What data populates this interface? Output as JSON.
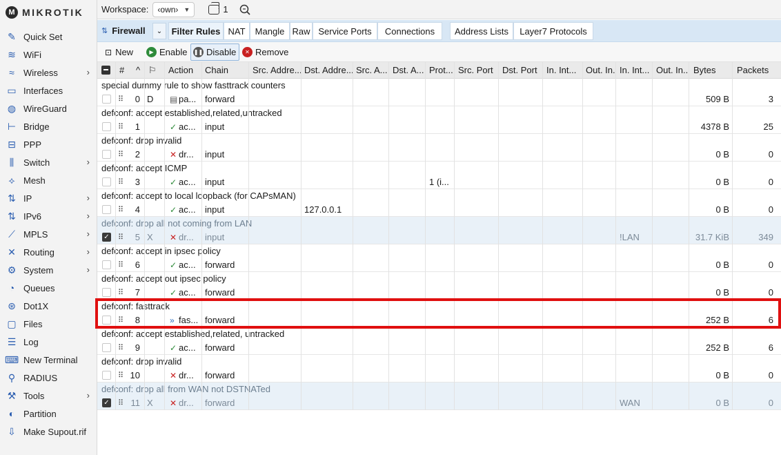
{
  "brand": "MIKROTIK",
  "nav": [
    {
      "label": "Quick Set",
      "icon": "wand-icon",
      "glyph": "✎",
      "chevron": false
    },
    {
      "label": "WiFi",
      "icon": "wifi-icon",
      "glyph": "≋",
      "chevron": false
    },
    {
      "label": "Wireless",
      "icon": "wireless-icon",
      "glyph": "≈",
      "chevron": true
    },
    {
      "label": "Interfaces",
      "icon": "interfaces-icon",
      "glyph": "▭",
      "chevron": false
    },
    {
      "label": "WireGuard",
      "icon": "wireguard-icon",
      "glyph": "◍",
      "chevron": false
    },
    {
      "label": "Bridge",
      "icon": "bridge-icon",
      "glyph": "⊢",
      "chevron": false
    },
    {
      "label": "PPP",
      "icon": "ppp-icon",
      "glyph": "⊟",
      "chevron": false
    },
    {
      "label": "Switch",
      "icon": "switch-icon",
      "glyph": "⫼",
      "chevron": true
    },
    {
      "label": "Mesh",
      "icon": "mesh-icon",
      "glyph": "⟡",
      "chevron": false
    },
    {
      "label": "IP",
      "icon": "ip-icon",
      "glyph": "⇅",
      "chevron": true
    },
    {
      "label": "IPv6",
      "icon": "ipv6-icon",
      "glyph": "⇅",
      "chevron": true
    },
    {
      "label": "MPLS",
      "icon": "mpls-icon",
      "glyph": "⟋",
      "chevron": true
    },
    {
      "label": "Routing",
      "icon": "routing-icon",
      "glyph": "✕",
      "chevron": true
    },
    {
      "label": "System",
      "icon": "system-icon",
      "glyph": "⚙",
      "chevron": true
    },
    {
      "label": "Queues",
      "icon": "queues-icon",
      "glyph": "◔",
      "chevron": false
    },
    {
      "label": "Dot1X",
      "icon": "dot1x-icon",
      "glyph": "⊛",
      "chevron": false
    },
    {
      "label": "Files",
      "icon": "files-icon",
      "glyph": "▢",
      "chevron": false
    },
    {
      "label": "Log",
      "icon": "log-icon",
      "glyph": "☰",
      "chevron": false
    },
    {
      "label": "New Terminal",
      "icon": "terminal-icon",
      "glyph": "⌨",
      "chevron": false
    },
    {
      "label": "RADIUS",
      "icon": "radius-icon",
      "glyph": "⚲",
      "chevron": false
    },
    {
      "label": "Tools",
      "icon": "tools-icon",
      "glyph": "⚒",
      "chevron": true
    },
    {
      "label": "Partition",
      "icon": "partition-icon",
      "glyph": "◐",
      "chevron": false
    },
    {
      "label": "Make Supout.rif",
      "icon": "supout-icon",
      "glyph": "⇩",
      "chevron": false
    }
  ],
  "topbar": {
    "workspace_label": "Workspace:",
    "workspace_value": "‹own›",
    "windows_count": "1"
  },
  "firewall": {
    "title": "Firewall",
    "tabs": [
      "Filter Rules",
      "NAT",
      "Mangle",
      "Raw",
      "Service Ports",
      "Connections",
      "Address Lists",
      "Layer7 Protocols"
    ],
    "active_tab": "Filter Rules"
  },
  "toolbar": {
    "new": "New",
    "enable": "Enable",
    "disable": "Disable",
    "remove": "Remove"
  },
  "columns": [
    "#",
    "Action",
    "Chain",
    "Src. Addre...",
    "Dst. Addre...",
    "Src. A...",
    "Dst. A...",
    "Prot...",
    "Src. Port",
    "Dst. Port",
    "In. Int...",
    "Out. In...",
    "In. Int...",
    "Out. In...",
    "Bytes",
    "Packets"
  ],
  "rules": [
    {
      "comment": "special dummy rule to show fasttrack counters",
      "num": "0",
      "flag": "D",
      "action": "pa...",
      "action_type": "pass",
      "chain": "forward",
      "dst": "",
      "proto": "",
      "in_list": "",
      "bytes": "509 B",
      "packets": "3",
      "disabled": false
    },
    {
      "comment": "defconf: accept established,related,untracked",
      "num": "1",
      "flag": "",
      "action": "ac...",
      "action_type": "accept",
      "chain": "input",
      "dst": "",
      "proto": "",
      "in_list": "",
      "bytes": "4378 B",
      "packets": "25",
      "disabled": false
    },
    {
      "comment": "defconf: drop invalid",
      "num": "2",
      "flag": "",
      "action": "dr...",
      "action_type": "drop",
      "chain": "input",
      "dst": "",
      "proto": "",
      "in_list": "",
      "bytes": "0 B",
      "packets": "0",
      "disabled": false
    },
    {
      "comment": "defconf: accept ICMP",
      "num": "3",
      "flag": "",
      "action": "ac...",
      "action_type": "accept",
      "chain": "input",
      "dst": "",
      "proto": "1 (i...",
      "in_list": "",
      "bytes": "0 B",
      "packets": "0",
      "disabled": false
    },
    {
      "comment": "defconf: accept to local loopback (for CAPsMAN)",
      "num": "4",
      "flag": "",
      "action": "ac...",
      "action_type": "accept",
      "chain": "input",
      "dst": "127.0.0.1",
      "proto": "",
      "in_list": "",
      "bytes": "0 B",
      "packets": "0",
      "disabled": false
    },
    {
      "comment": "defconf: drop all not coming from LAN",
      "num": "5",
      "flag": "X",
      "action": "dr...",
      "action_type": "drop",
      "chain": "input",
      "dst": "",
      "proto": "",
      "in_list": "!LAN",
      "bytes": "31.7 KiB",
      "packets": "349",
      "disabled": true
    },
    {
      "comment": "defconf: accept in ipsec policy",
      "num": "6",
      "flag": "",
      "action": "ac...",
      "action_type": "accept",
      "chain": "forward",
      "dst": "",
      "proto": "",
      "in_list": "",
      "bytes": "0 B",
      "packets": "0",
      "disabled": false
    },
    {
      "comment": "defconf: accept out ipsec policy",
      "num": "7",
      "flag": "",
      "action": "ac...",
      "action_type": "accept",
      "chain": "forward",
      "dst": "",
      "proto": "",
      "in_list": "",
      "bytes": "0 B",
      "packets": "0",
      "disabled": false
    },
    {
      "comment": "defconf: fasttrack",
      "num": "8",
      "flag": "",
      "action": "fas...",
      "action_type": "fast",
      "chain": "forward",
      "dst": "",
      "proto": "",
      "in_list": "",
      "bytes": "252 B",
      "packets": "6",
      "disabled": false
    },
    {
      "comment": "defconf: accept established,related, untracked",
      "num": "9",
      "flag": "",
      "action": "ac...",
      "action_type": "accept",
      "chain": "forward",
      "dst": "",
      "proto": "",
      "in_list": "",
      "bytes": "252 B",
      "packets": "6",
      "disabled": false
    },
    {
      "comment": "defconf: drop invalid",
      "num": "10",
      "flag": "",
      "action": "dr...",
      "action_type": "drop",
      "chain": "forward",
      "dst": "",
      "proto": "",
      "in_list": "",
      "bytes": "0 B",
      "packets": "0",
      "disabled": false
    },
    {
      "comment": "defconf: drop all from WAN not DSTNATed",
      "num": "11",
      "flag": "X",
      "action": "dr...",
      "action_type": "drop",
      "chain": "forward",
      "dst": "",
      "proto": "",
      "in_list": "WAN",
      "bytes": "0 B",
      "packets": "0",
      "disabled": true
    }
  ],
  "highlighted_rule": "8",
  "colors": {
    "accent": "#2a5db0",
    "tabs_bg": "#d8e7f5",
    "highlight": "#e01010",
    "accept": "#2e8b3a",
    "drop": "#c82020"
  }
}
